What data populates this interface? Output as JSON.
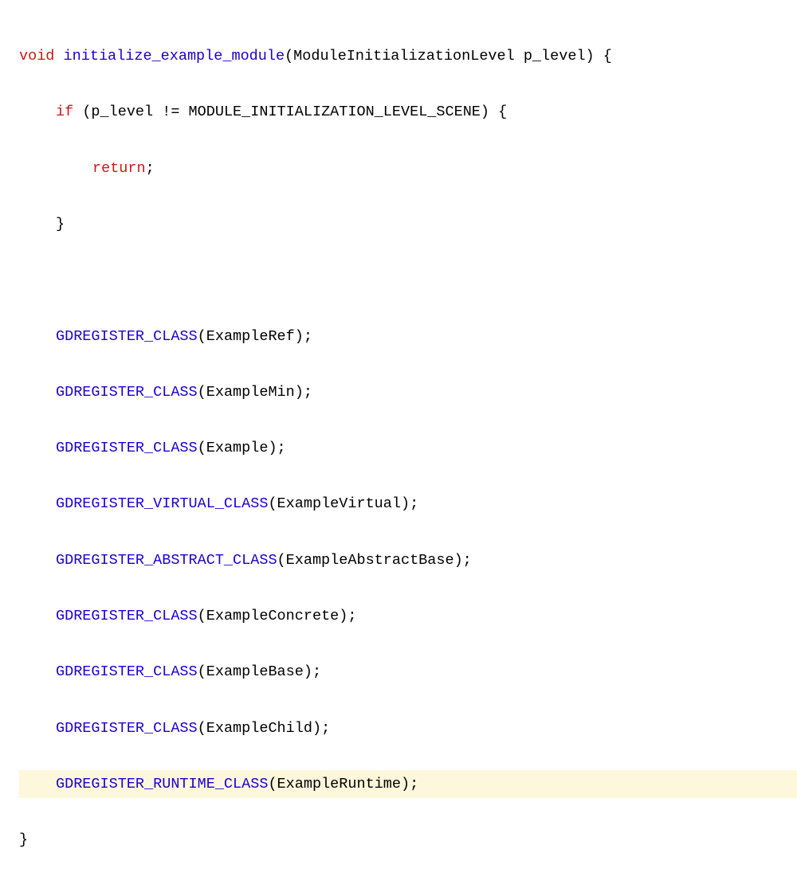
{
  "code": {
    "l1_kw": "void",
    "l1_fn": "initialize_example_module",
    "l1_rest": "(ModuleInitializationLevel p_level) {",
    "l2_kw": "if",
    "l2_rest": " (p_level != MODULE_INITIALIZATION_LEVEL_SCENE) {",
    "l3_kw": "return",
    "l3_rest": ";",
    "l4": "}",
    "l5": "",
    "l6_fn": "GDREGISTER_CLASS",
    "l6_rest": "(ExampleRef);",
    "l7_fn": "GDREGISTER_CLASS",
    "l7_rest": "(ExampleMin);",
    "l8_fn": "GDREGISTER_CLASS",
    "l8_rest": "(Example);",
    "l9_fn": "GDREGISTER_VIRTUAL_CLASS",
    "l9_rest": "(ExampleVirtual);",
    "l10_fn": "GDREGISTER_ABSTRACT_CLASS",
    "l10_rest": "(ExampleAbstractBase);",
    "l11_fn": "GDREGISTER_CLASS",
    "l11_rest": "(ExampleConcrete);",
    "l12_fn": "GDREGISTER_CLASS",
    "l12_rest": "(ExampleBase);",
    "l13_fn": "GDREGISTER_CLASS",
    "l13_rest": "(ExampleChild);",
    "l14_fn": "GDREGISTER_RUNTIME_CLASS",
    "l14_rest": "(ExampleRuntime);",
    "l15": "}"
  }
}
